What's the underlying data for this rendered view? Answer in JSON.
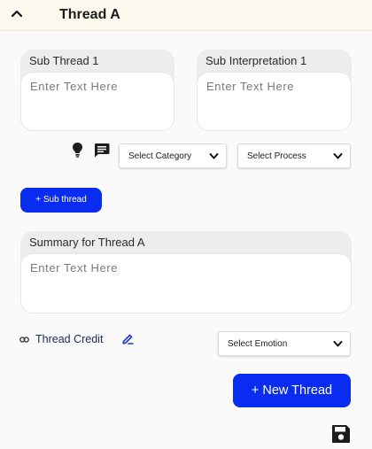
{
  "header": {
    "title": "Thread A"
  },
  "sub_thread": {
    "label": "Sub Thread 1",
    "placeholder": "Enter Text Here"
  },
  "sub_interpretation": {
    "label": "Sub Interpretation 1",
    "placeholder": "Enter Text Here"
  },
  "selects": {
    "category": "Select Category",
    "process": "Select Process",
    "emotion": "Select Emotion"
  },
  "buttons": {
    "sub_thread": "+ Sub thread",
    "new_thread": "+ New Thread"
  },
  "summary": {
    "label": "Summary for Thread A",
    "placeholder": "Enter Text Here"
  },
  "credit": {
    "label": "Thread Credit"
  },
  "icons": {
    "collapse": "chevron-up-icon",
    "hint": "lightbulb-icon",
    "comment": "comment-icon",
    "link": "link-icon",
    "edit": "pencil-icon",
    "save": "save-icon"
  },
  "colors": {
    "accent": "#0a2cf0",
    "header_bg": "#fbf9ee",
    "card_bg": "#ededed"
  }
}
